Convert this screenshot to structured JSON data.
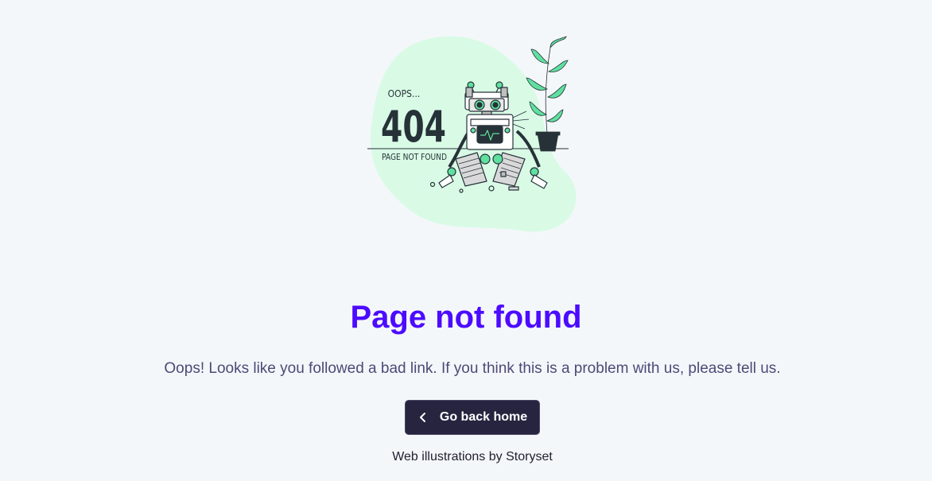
{
  "illustration": {
    "oops_text": "OOPS...",
    "code_text": "404",
    "caption_text": "PAGE NOT FOUND",
    "colors": {
      "blob": "#d9fbe6",
      "accent_green": "#5fe0a0",
      "dark": "#263238"
    }
  },
  "main": {
    "title": "Page not found",
    "message": "Oops! Looks like you followed a bad link. If you think this is a problem with us, please tell us.",
    "back_button": {
      "label": "Go back home",
      "icon": "chevron-left-icon"
    }
  },
  "footer": {
    "credit_prefix": "Web illustrations by ",
    "credit_link": "Storyset"
  },
  "colors": {
    "background": "#f4f7fa",
    "title": "#4c0bff",
    "message": "#4d4a77",
    "button_bg": "#272440",
    "button_text": "#ffffff"
  }
}
